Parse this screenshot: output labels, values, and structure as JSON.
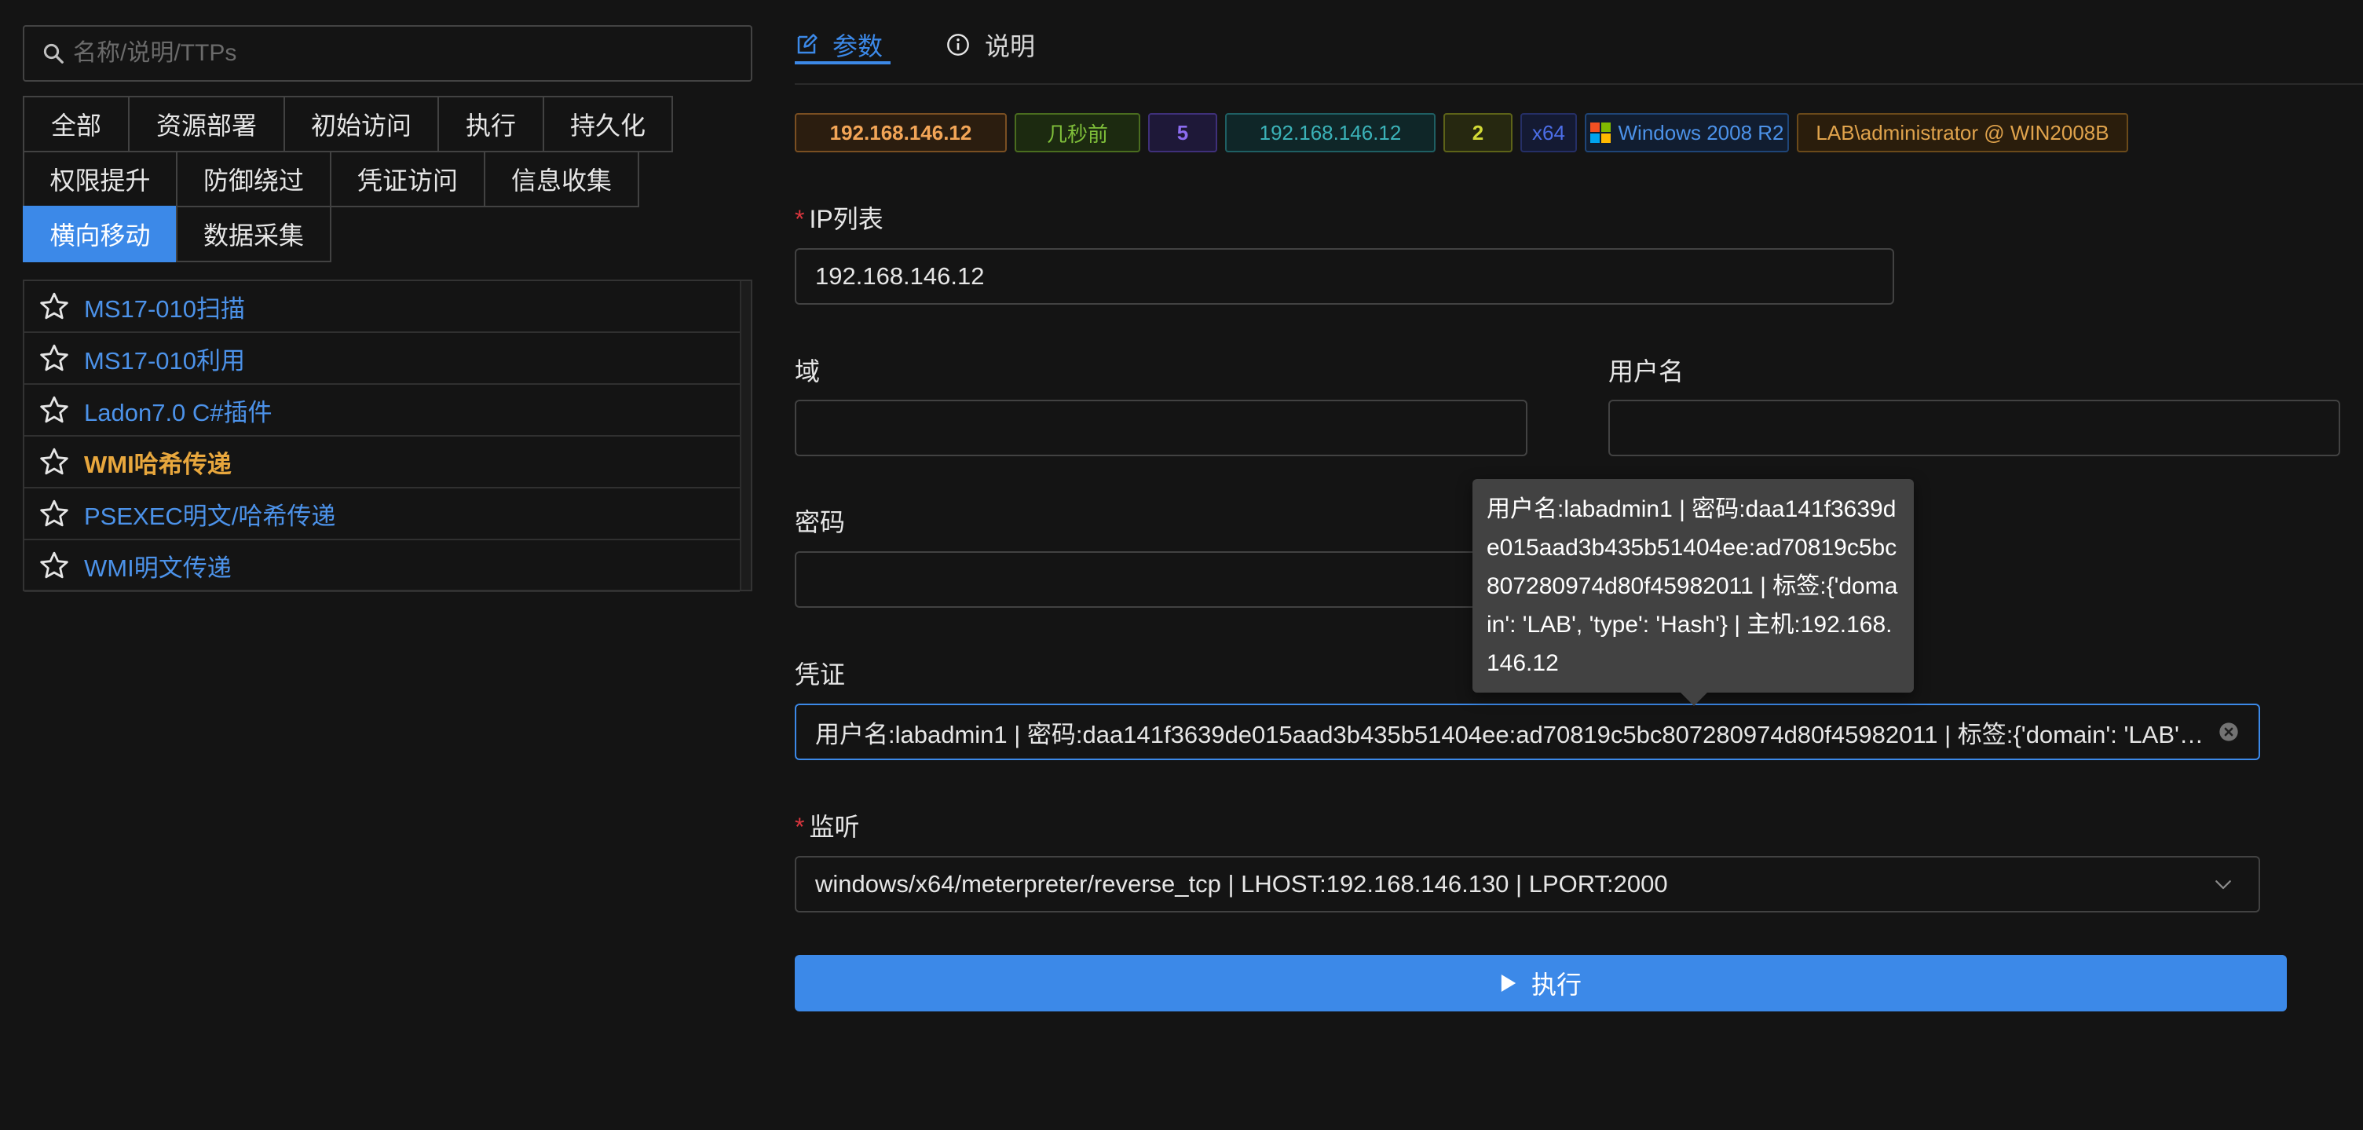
{
  "search": {
    "placeholder": "名称/说明/TTPs"
  },
  "categories": [
    {
      "label": "全部",
      "active": false
    },
    {
      "label": "资源部署",
      "active": false
    },
    {
      "label": "初始访问",
      "active": false
    },
    {
      "label": "执行",
      "active": false
    },
    {
      "label": "持久化",
      "active": false
    },
    {
      "label": "权限提升",
      "active": false
    },
    {
      "label": "防御绕过",
      "active": false
    },
    {
      "label": "凭证访问",
      "active": false
    },
    {
      "label": "信息收集",
      "active": false
    },
    {
      "label": "横向移动",
      "active": true
    },
    {
      "label": "数据采集",
      "active": false
    }
  ],
  "modules": [
    {
      "label": "MS17-010扫描",
      "selected": false
    },
    {
      "label": "MS17-010利用",
      "selected": false
    },
    {
      "label": "Ladon7.0 C#插件",
      "selected": false
    },
    {
      "label": "WMI哈希传递",
      "selected": true
    },
    {
      "label": "PSEXEC明文/哈希传递",
      "selected": false
    },
    {
      "label": "WMI明文传递",
      "selected": false
    }
  ],
  "tabs": {
    "params": "参数",
    "info": "说明"
  },
  "badges": {
    "ip": "192.168.146.12",
    "time": "几秒前",
    "num": "5",
    "ip2": "192.168.146.12",
    "count": "2",
    "arch": "x64",
    "os": "Windows 2008 R2",
    "user": "LAB\\administrator @ WIN2008B"
  },
  "form": {
    "ip_list": {
      "label": "IP列表",
      "required": "*",
      "value": "192.168.146.12"
    },
    "domain": {
      "label": "域",
      "value": ""
    },
    "username": {
      "label": "用户名",
      "value": ""
    },
    "password": {
      "label": "密码",
      "value": ""
    },
    "credential": {
      "label": "凭证",
      "value": "用户名:labadmin1 | 密码:daa141f3639de015aad3b435b51404ee:ad70819c5bc807280974d80f45982011 | 标签:{'domain': 'LAB', 'type': 'Hash'} | 主机:192.168.146.12"
    },
    "listener": {
      "label": "监听",
      "required": "*",
      "value": "windows/x64/meterpreter/reverse_tcp | LHOST:192.168.146.130 | LPORT:2000"
    },
    "run_label": "执行"
  },
  "tooltip": {
    "text": "用户名:labadmin1 | 密码:daa141f3639de015aad3b435b51404ee:ad70819c5bc807280974d80f45982011 | 标签:{'domain': 'LAB', 'type': 'Hash'} | 主机:192.168.146.12"
  },
  "colors": {
    "accent": "#3c89e8",
    "selected_module": "#e8a73d",
    "module_link": "#4c92e9",
    "background": "#141414"
  }
}
